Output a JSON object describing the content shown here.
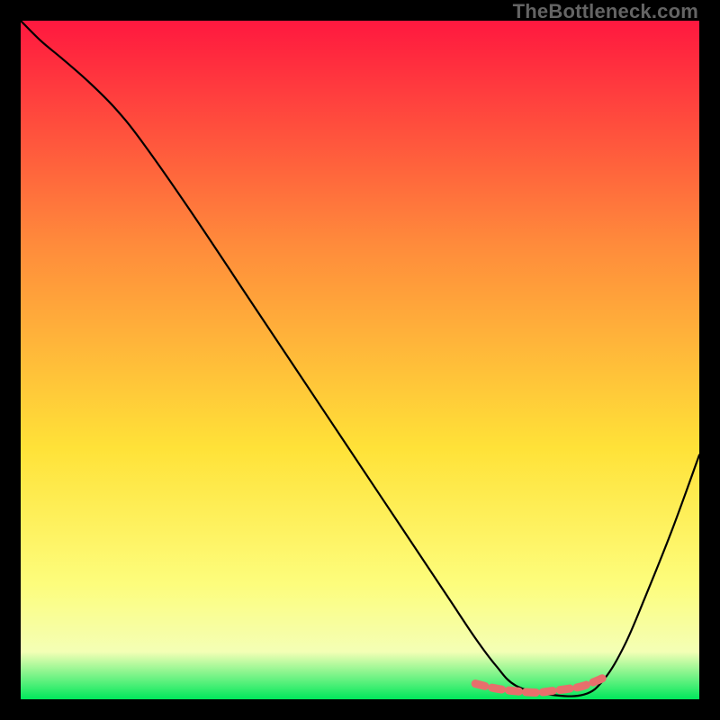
{
  "watermark": "TheBottleneck.com",
  "colors": {
    "gradient_top": "#ff183f",
    "gradient_mid1": "#ff8b3b",
    "gradient_mid2": "#ffe238",
    "gradient_mid3": "#fdfd7c",
    "gradient_mid4": "#f4ffb5",
    "gradient_bottom": "#00e85b",
    "curve": "#000000",
    "highlight": "#e86f6c",
    "background": "#000000"
  },
  "chart_data": {
    "type": "line",
    "title": "",
    "xlabel": "",
    "ylabel": "",
    "xlim": [
      0,
      100
    ],
    "ylim": [
      0,
      100
    ],
    "series": [
      {
        "name": "bottleneck-curve",
        "x": [
          0,
          3,
          6,
          10,
          14,
          18,
          25,
          35,
          45,
          55,
          63,
          67,
          70,
          73,
          78,
          83,
          86,
          89,
          92,
          96,
          100
        ],
        "y": [
          100,
          97,
          94.5,
          91,
          87,
          82,
          72,
          57,
          42,
          27,
          15,
          9,
          5,
          2,
          0.7,
          0.7,
          3,
          8,
          15,
          25,
          36
        ]
      },
      {
        "name": "optimal-zone-highlight",
        "x": [
          67,
          70,
          73,
          76,
          78,
          81,
          83,
          86
        ],
        "y": [
          2.3,
          1.6,
          1.2,
          1.0,
          1.2,
          1.6,
          2.0,
          3.2
        ]
      }
    ],
    "annotations": []
  }
}
